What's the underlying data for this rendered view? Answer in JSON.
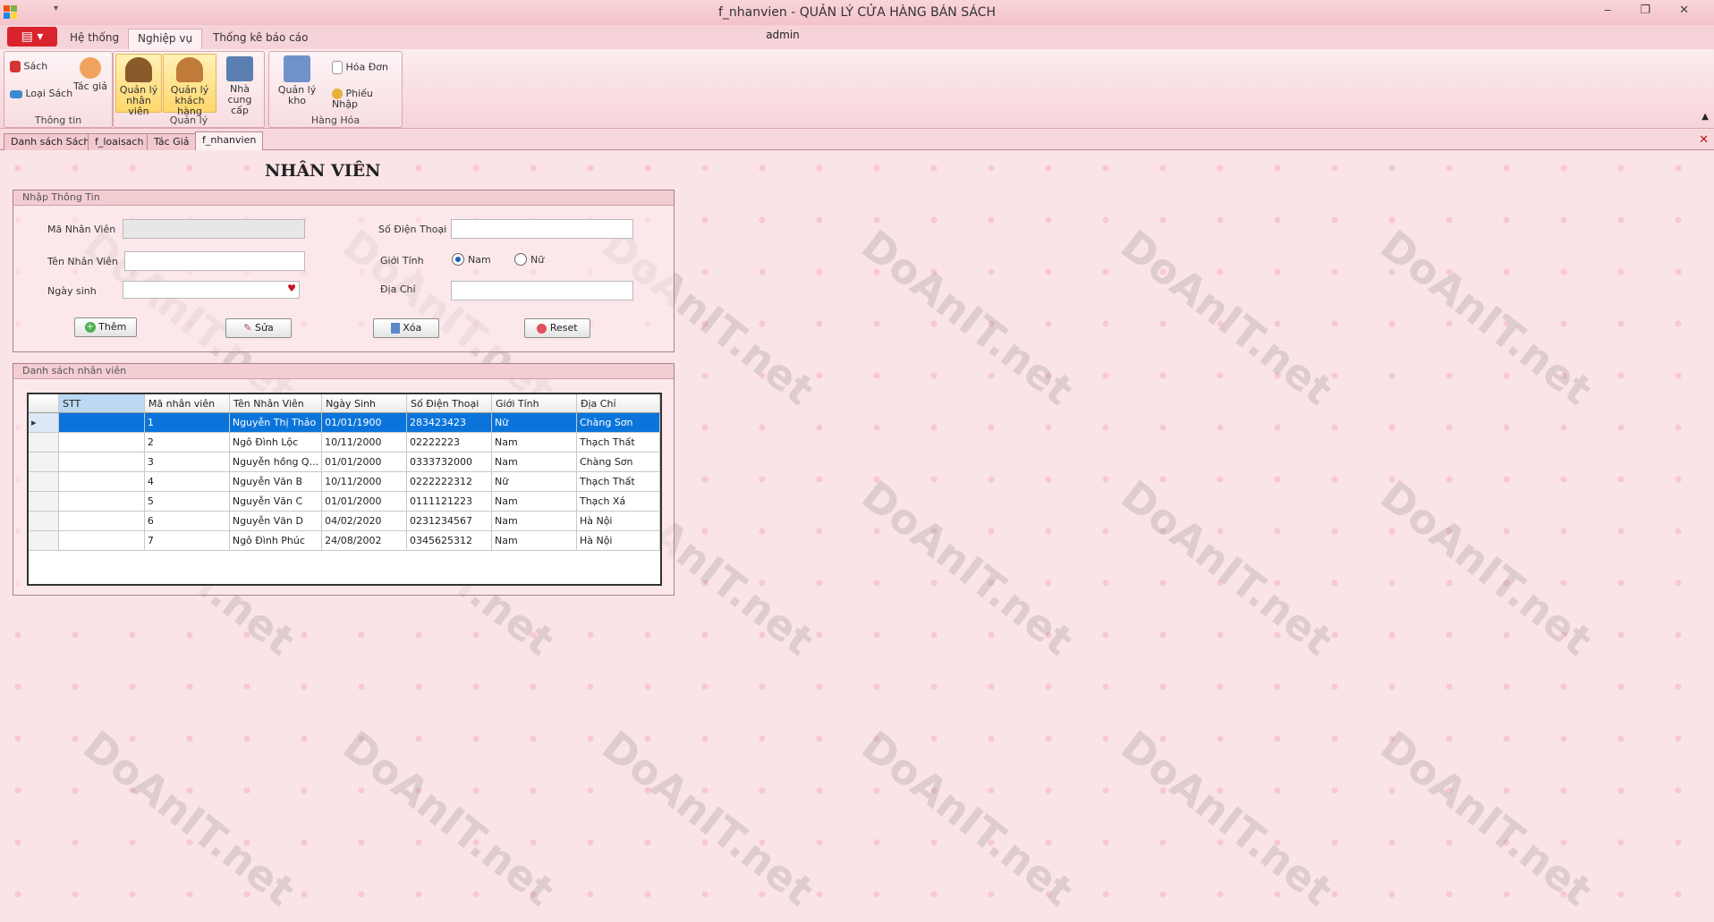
{
  "window": {
    "title": "f_nhanvien - QUẢN LÝ CỬA HÀNG BÁN SÁCH",
    "user": "admin",
    "controls": "‒ ❐ ✕"
  },
  "menu": {
    "tabs": [
      "Hệ thống",
      "Nghiệp vụ",
      "Thống kê báo cáo"
    ],
    "active": "Nghiệp vụ"
  },
  "ribbon": {
    "thongtin": {
      "label": "Thông tin",
      "sach": "Sách",
      "tacgia": "Tác giả",
      "loaisach": "Loại Sách"
    },
    "quanly": {
      "label": "Quản lý",
      "nhanvien": "Quản lý nhân viên",
      "khachhang": "Quản lý khách hàng",
      "nhacungcap": "Nhà cung cấp"
    },
    "hanghoa": {
      "label": "Hàng Hóa",
      "kho": "Quản lý kho",
      "hoadon": "Hóa Đơn",
      "phieunhap": "Phiếu Nhập"
    }
  },
  "doc_tabs": [
    "Danh sách Sách",
    "f_loaisach",
    "Tác Giả",
    "f_nhanvien"
  ],
  "form": {
    "title": "NHÂN VIÊN",
    "group_input": "Nhập Thông Tin",
    "labels": {
      "ma": "Mã Nhân Viên",
      "ten": "Tên Nhân Viên",
      "ngaysinh": "Ngày sinh",
      "sdt": "Số Điện Thoại",
      "gioitinh": "Giới Tính",
      "diachi": "Địa Chỉ"
    },
    "values": {
      "ma": "",
      "ten": "",
      "ngaysinh": "",
      "sdt": "",
      "diachi": ""
    },
    "radio": {
      "nam": "Nam",
      "nu": "Nữ",
      "selected": "Nam"
    },
    "buttons": {
      "them": "Thêm",
      "sua": "Sửa",
      "xoa": "Xóa",
      "reset": "Reset"
    },
    "group_list": "Danh sách nhân viên"
  },
  "grid": {
    "columns": [
      "STT",
      "Mã nhân viên",
      "Tên Nhân Viên",
      "Ngày Sinh",
      "Số Điện Thoại",
      "Giới Tính",
      "Địa Chỉ"
    ],
    "rows": [
      [
        "",
        "1",
        "Nguyễn Thị Thảo",
        "01/01/1900",
        "283423423",
        "Nữ",
        "Chàng Sơn"
      ],
      [
        "",
        "2",
        "Ngô Đình Lộc",
        "10/11/2000",
        "02222223",
        "Nam",
        "Thạch Thất"
      ],
      [
        "",
        "3",
        "Nguyễn hồng Q...",
        "01/01/2000",
        "0333732000",
        "Nam",
        "Chàng Sơn"
      ],
      [
        "",
        "4",
        "Nguyễn Văn B",
        "10/11/2000",
        "0222222312",
        "Nữ",
        "Thạch Thất"
      ],
      [
        "",
        "5",
        "Nguyễn Văn C",
        "01/01/2000",
        "0111121223",
        "Nam",
        "Thạch Xá"
      ],
      [
        "",
        "6",
        "Nguyễn Văn D",
        "04/02/2020",
        "0231234567",
        "Nam",
        "Hà Nội"
      ],
      [
        "",
        "7",
        "Ngô Đình Phúc",
        "24/08/2002",
        "0345625312",
        "Nam",
        "Hà Nội"
      ]
    ],
    "selected_row": 0
  },
  "watermark": "DoAnIT.net",
  "colors": {
    "accent": "#d9232d",
    "selection": "#0a74db",
    "background": "#fbe4e7"
  }
}
